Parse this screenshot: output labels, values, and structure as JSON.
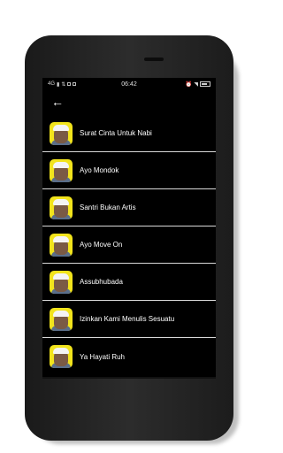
{
  "status_bar": {
    "network": "4G",
    "time": "06:42"
  },
  "toolbar": {
    "back_icon": "arrow-left-icon"
  },
  "songs": [
    {
      "title": "Surat Cinta Untuk Nabi"
    },
    {
      "title": "Ayo Mondok"
    },
    {
      "title": "Santri Bukan Artis"
    },
    {
      "title": "Ayo Move On"
    },
    {
      "title": "Assubhubada"
    },
    {
      "title": "Izinkan Kami Menulis Sesuatu"
    },
    {
      "title": "Ya Hayati Ruh"
    }
  ],
  "colors": {
    "screen_bg": "#000000",
    "thumb_bg": "#f2e41c",
    "text": "#ffffff",
    "divider": "#d9d9d9"
  }
}
